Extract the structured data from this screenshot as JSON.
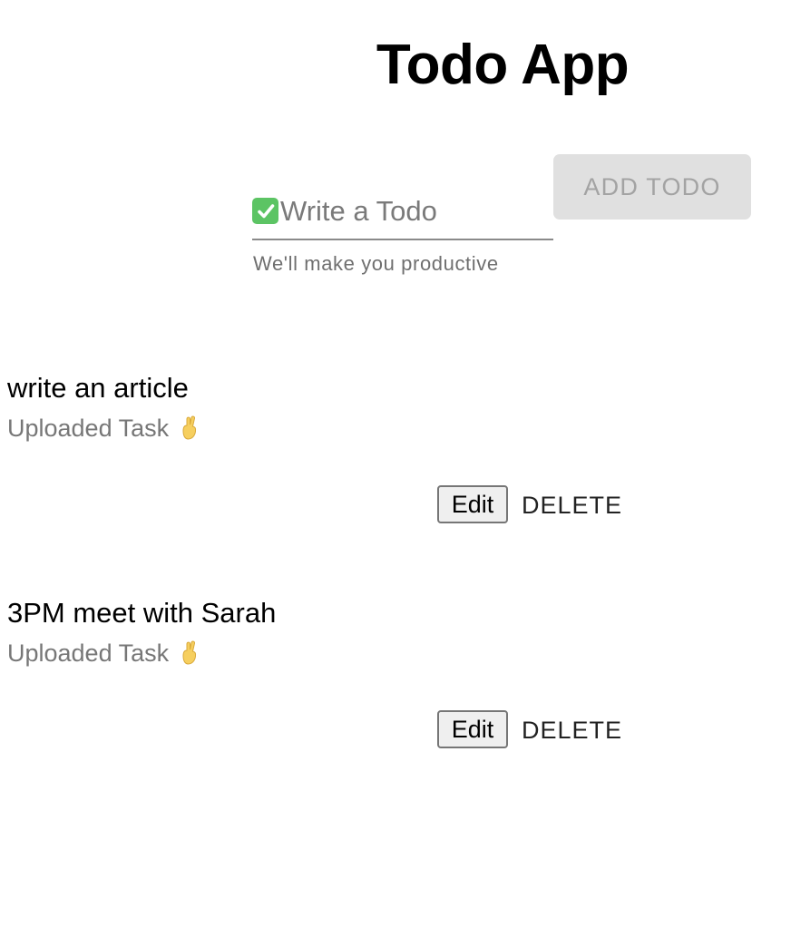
{
  "header": {
    "title": "Todo App"
  },
  "form": {
    "input_value": "",
    "input_placeholder": "Write a Todo",
    "input_icon": "check-mark-button-emoji",
    "helper_text": "We'll make you productive",
    "add_button_label": "ADD TODO",
    "add_button_disabled": true
  },
  "todos": [
    {
      "text": "write an article",
      "status": "Uploaded Task",
      "status_icon": "crossed-fingers-emoji",
      "edit_label": "Edit",
      "delete_label": "DELETE"
    },
    {
      "text": "3PM meet with Sarah",
      "status": "Uploaded Task",
      "status_icon": "crossed-fingers-emoji",
      "edit_label": "Edit",
      "delete_label": "DELETE"
    }
  ],
  "colors": {
    "check_icon": "#5cc464",
    "button_disabled_bg": "#e0e0e0",
    "button_disabled_text": "#a3a3a3",
    "secondary_text": "#777777"
  }
}
